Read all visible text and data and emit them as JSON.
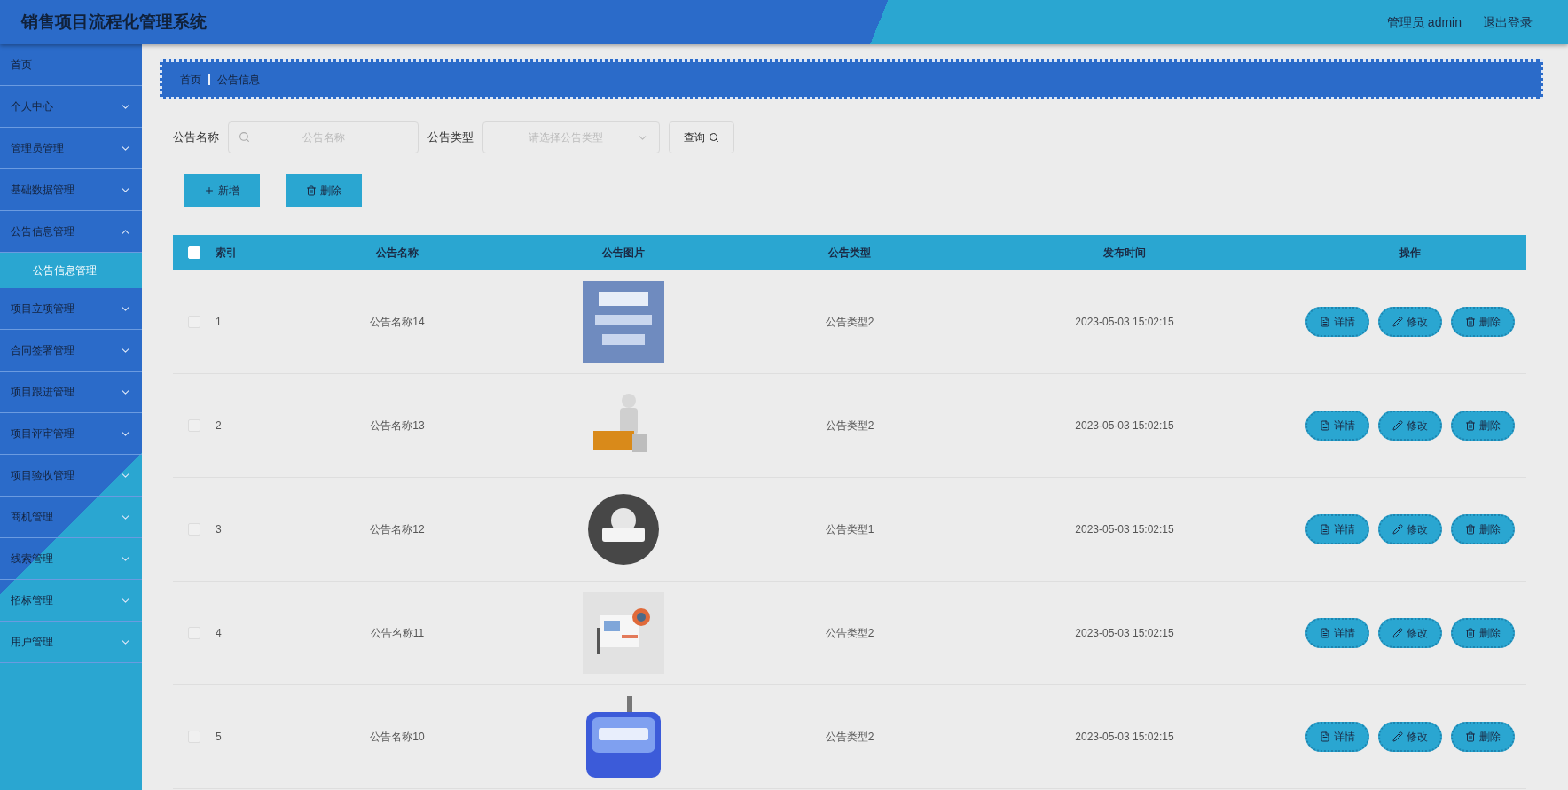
{
  "header": {
    "title": "销售项目流程化管理系统",
    "user": "管理员 admin",
    "logout": "退出登录"
  },
  "sidebar": {
    "items": [
      {
        "label": "首页"
      },
      {
        "label": "个人中心",
        "expanded": false
      },
      {
        "label": "管理员管理",
        "expanded": false
      },
      {
        "label": "基础数据管理",
        "expanded": false
      },
      {
        "label": "公告信息管理",
        "expanded": true,
        "children": [
          {
            "label": "公告信息管理",
            "selected": true
          }
        ]
      },
      {
        "label": "项目立项管理",
        "expanded": false
      },
      {
        "label": "合同签署管理",
        "expanded": false
      },
      {
        "label": "项目跟进管理",
        "expanded": false
      },
      {
        "label": "项目评审管理",
        "expanded": false
      },
      {
        "label": "项目验收管理",
        "expanded": false
      },
      {
        "label": "商机管理",
        "expanded": false
      },
      {
        "label": "线索管理",
        "expanded": false
      },
      {
        "label": "招标管理",
        "expanded": false
      },
      {
        "label": "用户管理",
        "expanded": false
      }
    ]
  },
  "breadcrumb": [
    "首页",
    "公告信息"
  ],
  "search": {
    "name_label": "公告名称",
    "name_placeholder": "公告名称",
    "type_label": "公告类型",
    "type_placeholder": "请选择公告类型",
    "query_button": "查询"
  },
  "actions": [
    "新增",
    "删除"
  ],
  "table": {
    "header_checked": false,
    "columns": [
      "索引",
      "公告名称",
      "公告图片",
      "公告类型",
      "发布时间",
      "操作"
    ],
    "rows": [
      {
        "checked": false,
        "index": "1",
        "name": "公告名称14",
        "type": "公告类型2",
        "time": "2023-05-03 15:02:15",
        "buttons": [
          "详情",
          "修改",
          "删除"
        ]
      },
      {
        "checked": false,
        "index": "2",
        "name": "公告名称13",
        "type": "公告类型2",
        "time": "2023-05-03 15:02:15",
        "buttons": [
          "详情",
          "修改",
          "删除"
        ]
      },
      {
        "checked": false,
        "index": "3",
        "name": "公告名称12",
        "type": "公告类型1",
        "time": "2023-05-03 15:02:15",
        "buttons": [
          "详情",
          "修改",
          "删除"
        ]
      },
      {
        "checked": false,
        "index": "4",
        "name": "公告名称11",
        "type": "公告类型2",
        "time": "2023-05-03 15:02:15",
        "buttons": [
          "详情",
          "修改",
          "删除"
        ]
      },
      {
        "checked": false,
        "index": "5",
        "name": "公告名称10",
        "type": "公告类型2",
        "time": "2023-05-03 15:02:15",
        "buttons": [
          "详情",
          "修改",
          "删除"
        ]
      }
    ]
  }
}
